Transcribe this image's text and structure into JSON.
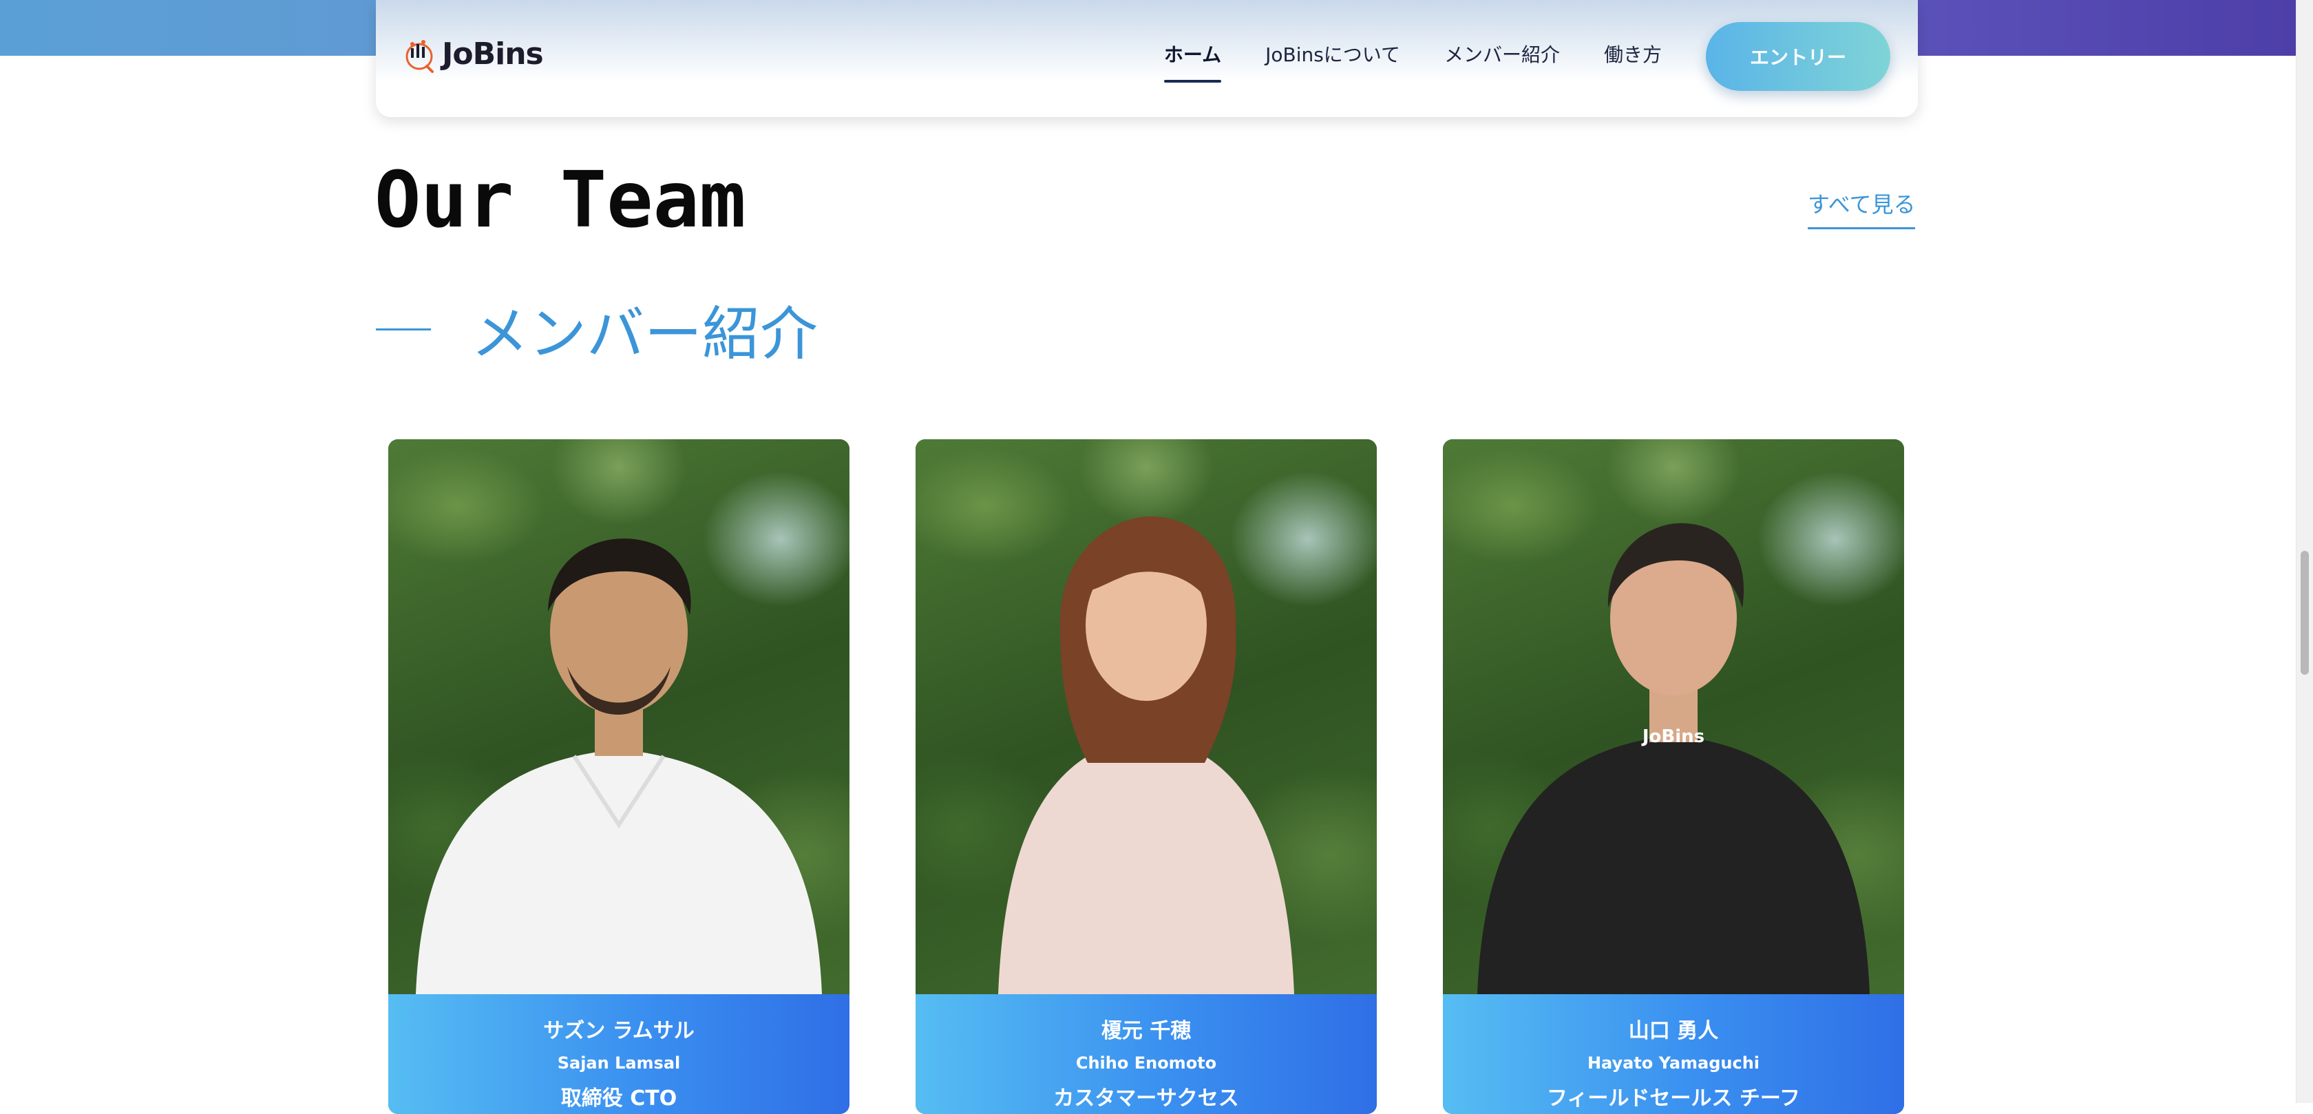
{
  "header": {
    "logo_text": "JoBins",
    "nav": [
      "ホーム",
      "JoBinsについて",
      "メンバー紹介",
      "働き方"
    ],
    "entry_label": "エントリー"
  },
  "section": {
    "title": "Our Team",
    "see_all": "すべて見る",
    "subtitle": "メンバー紹介"
  },
  "members": [
    {
      "name_ja": "サズン ラムサル",
      "name_en": "Sajan Lamsal",
      "role": "取締役 CTO",
      "shirt": "white"
    },
    {
      "name_ja": "榎元 千穂",
      "name_en": "Chiho Enomoto",
      "role": "カスタマーサクセス",
      "shirt": "pink"
    },
    {
      "name_ja": "山口 勇人",
      "name_en": "Hayato Yamaguchi",
      "role": "フィールドセールス チーフ",
      "shirt": "black",
      "shirt_logo": "JoBins"
    }
  ],
  "colors": {
    "accent": "#3b95d8",
    "card_gradient_start": "#56bdf2",
    "card_gradient_end": "#2f6fe6",
    "entry_gradient_start": "#5ab4e8",
    "entry_gradient_end": "#7fd4d6"
  }
}
